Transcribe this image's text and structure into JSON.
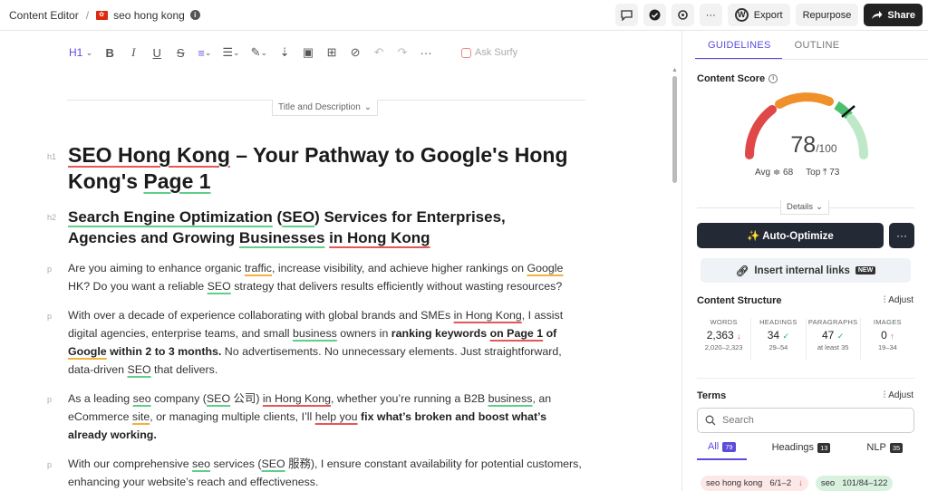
{
  "topbar": {
    "app": "Content Editor",
    "sep": "/",
    "doc_title": "seo hong kong",
    "export_label": "Export",
    "repurpose_label": "Repurpose",
    "share_label": "Share"
  },
  "toolbar": {
    "heading": "H1",
    "ask_label": "Ask Surfy"
  },
  "editor": {
    "title_desc_label": "Title and Description",
    "h1_label": "h1",
    "h2_label": "h2",
    "p_label": "p",
    "h1": {
      "a": "SEO Hong Kong",
      "b": " – Your Pathway to Google's Hong Kong's ",
      "c": "Page 1"
    },
    "h2": {
      "a": "Search Engine Optimization",
      "b": " (",
      "c": "SEO",
      "d": ") Services for Enterprises, Agencies and Growing ",
      "e": "Businesses",
      "f": " ",
      "g": "in Hong Kong"
    },
    "p1": {
      "a": "Are you aiming to enhance organic ",
      "b": "traffic",
      "c": ", increase visibility, and achieve higher rankings on ",
      "d": "Google",
      "e": " HK? Do you want a reliable ",
      "f": "SEO",
      "g": " strategy that delivers results efficiently without wasting resources?"
    },
    "p2": {
      "a": "With over a decade of experience collaborating with global brands and SMEs ",
      "b": "in Hong Kong",
      "c": ", I assist digital agencies, enterprise teams, and small ",
      "d": "business",
      "e": " owners in ",
      "f": "ranking keywords ",
      "g": "on Page 1",
      "h": " of ",
      "i": "Google",
      "j": " within 2 to 3 months.",
      "k": " No advertisements. No unnecessary elements. Just straightforward, data-driven ",
      "l": "SEO",
      "m": " that delivers."
    },
    "p3": {
      "a": "As a leading ",
      "b": "seo",
      "c": " company (",
      "d": "SEO",
      "e": " 公司) ",
      "f": "in Hong Kong",
      "g": ", whether you’re running a B2B ",
      "h": "business",
      "i": ", an eCommerce ",
      "j": "site",
      "k": ", or managing multiple clients, I’ll ",
      "l": "help you",
      "m": " ",
      "n": "fix what’s broken and boost what’s already working."
    },
    "p4": {
      "a": "With our comprehensive ",
      "b": "seo",
      "c": " services (",
      "d": "SEO",
      "e": " 服務), I ensure constant availability for potential customers, enhancing your website’s reach and effectiveness."
    }
  },
  "panel": {
    "tab_guidelines": "GUIDELINES",
    "tab_outline": "OUTLINE",
    "content_score_label": "Content Score",
    "score": 78,
    "score_max": "/100",
    "avg_label": "Avg",
    "avg_value": "68",
    "top_label": "Top",
    "top_value": "73",
    "details_label": "Details",
    "auto_optimize_label": "✨ Auto-Optimize",
    "internal_links_label": "Insert internal links",
    "new_badge": "NEW",
    "content_structure_label": "Content Structure",
    "adjust_label": "Adjust",
    "stats": [
      {
        "label": "WORDS",
        "value": "2,363",
        "range": "2,020–2,323",
        "dir": "down"
      },
      {
        "label": "HEADINGS",
        "value": "34",
        "range": "29–54",
        "dir": "ok"
      },
      {
        "label": "PARAGRAPHS",
        "value": "47",
        "range": "at least 35",
        "dir": "ok"
      },
      {
        "label": "IMAGES",
        "value": "0",
        "range": "19–34",
        "dir": "up"
      }
    ],
    "terms_label": "Terms",
    "search_placeholder": "Search",
    "filters": [
      {
        "label": "All",
        "count": "79"
      },
      {
        "label": "Headings",
        "count": "13"
      },
      {
        "label": "NLP",
        "count": "35"
      }
    ],
    "chips": [
      {
        "term": "seo hong kong",
        "count": "6/1–2",
        "dir": "↓"
      },
      {
        "term": "seo",
        "count": "101/84–122",
        "dir": ""
      }
    ],
    "colors": {
      "accent": "#5b4cdb",
      "gauge_red": "#e04848",
      "gauge_orange": "#f0902a",
      "gauge_green": "#4cc070",
      "gauge_light": "#bfe8c8"
    }
  }
}
